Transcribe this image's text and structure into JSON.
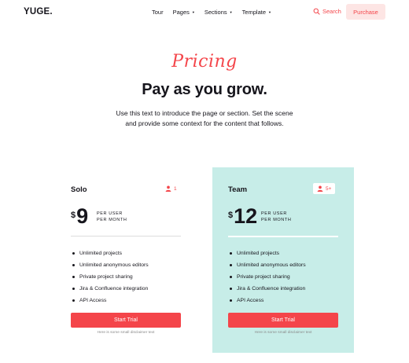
{
  "header": {
    "logo": "YUGE.",
    "nav": [
      {
        "label": "Tour",
        "has_caret": false
      },
      {
        "label": "Pages",
        "has_caret": true
      },
      {
        "label": "Sections",
        "has_caret": true
      },
      {
        "label": "Template",
        "has_caret": true
      }
    ],
    "search_label": "Search",
    "search_icon": "search-icon",
    "purchase_label": "Purchase"
  },
  "hero": {
    "eyebrow": "Pricing",
    "title": "Pay as you grow.",
    "description": "Use this text to introduce the page or section. Set the scene and provide some context for the content that follows."
  },
  "plans": [
    {
      "name": "Solo",
      "seats": "1",
      "currency": "$",
      "price": "9",
      "unit_line1": "PER USER",
      "unit_line2": "PER MONTH",
      "features": [
        "Unlimited projects",
        "Unlimited anonymous editors",
        "Private project sharing",
        "Jira & Confluence integration",
        "API Access"
      ],
      "cta": "Start Trial",
      "disclaimer": "Here is some small disclaimer text"
    },
    {
      "name": "Team",
      "seats": "5+",
      "currency": "$",
      "price": "12",
      "unit_line1": "PER USER",
      "unit_line2": "PER MONTH",
      "features": [
        "Unlimited projects",
        "Unlimited anonymous editors",
        "Private project sharing",
        "Jira & Confluence integration",
        "API Access"
      ],
      "cta": "Start Trial",
      "disclaimer": "Here is some small disclaimer text"
    }
  ],
  "colors": {
    "accent": "#f4454a",
    "accent_soft": "#fde5e4",
    "team_card_bg": "#c7ede8",
    "text": "#16151c"
  }
}
